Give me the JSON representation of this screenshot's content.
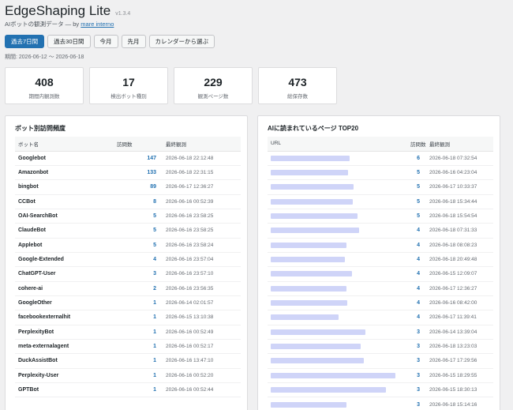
{
  "app": {
    "title": "EdgeShaping Lite",
    "version": "v1.3.4",
    "subtitle_prefix": "AIボットの観測データ — by",
    "author_link": "mare interno"
  },
  "filters": [
    {
      "label": "過去7日間",
      "active": true
    },
    {
      "label": "過去30日間",
      "active": false
    },
    {
      "label": "今月",
      "active": false
    },
    {
      "label": "先月",
      "active": false
    },
    {
      "label": "カレンダーから選ぶ",
      "active": false
    }
  ],
  "period": "期間: 2026-06-12 ～ 2026-06-18",
  "stats": [
    {
      "value": "408",
      "label": "期間内観測数"
    },
    {
      "value": "17",
      "label": "検出ボット種別"
    },
    {
      "value": "229",
      "label": "観測ページ数"
    },
    {
      "value": "473",
      "label": "総保存数"
    }
  ],
  "bot_panel": {
    "title": "ボット別訪問頻度",
    "headers": [
      "ボット名",
      "訪問数",
      "最終観測"
    ],
    "rows": [
      {
        "name": "Googlebot",
        "count": "147",
        "last": "2026-06-18 22:12:48"
      },
      {
        "name": "Amazonbot",
        "count": "133",
        "last": "2026-06-18 22:31:15"
      },
      {
        "name": "bingbot",
        "count": "89",
        "last": "2026-06-17 12:36:27"
      },
      {
        "name": "CCBot",
        "count": "8",
        "last": "2026-06-16 00:52:39"
      },
      {
        "name": "OAI-SearchBot",
        "count": "5",
        "last": "2026-06-16 23:58:25"
      },
      {
        "name": "ClaudeBot",
        "count": "5",
        "last": "2026-06-16 23:58:25"
      },
      {
        "name": "Applebot",
        "count": "5",
        "last": "2026-06-16 23:58:24"
      },
      {
        "name": "Google-Extended",
        "count": "4",
        "last": "2026-06-16 23:57:04"
      },
      {
        "name": "ChatGPT-User",
        "count": "3",
        "last": "2026-06-16 23:57:10"
      },
      {
        "name": "cohere-ai",
        "count": "2",
        "last": "2026-06-16 23:56:35"
      },
      {
        "name": "GoogleOther",
        "count": "1",
        "last": "2026-06-14 02:01:57"
      },
      {
        "name": "facebookexternalhit",
        "count": "1",
        "last": "2026-06-15 13:10:38"
      },
      {
        "name": "PerplexityBot",
        "count": "1",
        "last": "2026-06-16 00:52:49"
      },
      {
        "name": "meta-externalagent",
        "count": "1",
        "last": "2026-06-16 00:52:17"
      },
      {
        "name": "DuckAssistBot",
        "count": "1",
        "last": "2026-06-16 13:47:10"
      },
      {
        "name": "Perplexity-User",
        "count": "1",
        "last": "2026-06-16 00:52:20"
      },
      {
        "name": "GPTBot",
        "count": "1",
        "last": "2026-06-16 00:52:44"
      }
    ]
  },
  "page_panel": {
    "title": "AIに読まれているページ TOP20",
    "headers": [
      "URL",
      "訪問数",
      "最終観測"
    ],
    "rows": [
      {
        "count": "6",
        "last": "2026-06-18 07:32:54"
      },
      {
        "count": "5",
        "last": "2026-06-16 04:23:04"
      },
      {
        "count": "5",
        "last": "2026-06-17 10:33:37"
      },
      {
        "count": "5",
        "last": "2026-06-18 15:34:44"
      },
      {
        "count": "5",
        "last": "2026-06-18 15:54:54"
      },
      {
        "count": "4",
        "last": "2026-06-18 07:31:33"
      },
      {
        "count": "4",
        "last": "2026-06-18 08:08:23"
      },
      {
        "count": "4",
        "last": "2026-06-18 20:49:48"
      },
      {
        "count": "4",
        "last": "2026-06-15 12:09:07"
      },
      {
        "count": "4",
        "last": "2026-06-17 12:36:27"
      },
      {
        "count": "4",
        "last": "2026-06-16 08:42:00"
      },
      {
        "count": "4",
        "last": "2026-06-17 11:39:41"
      },
      {
        "count": "3",
        "last": "2026-06-14 13:39:04"
      },
      {
        "count": "3",
        "last": "2026-06-18 13:23:03"
      },
      {
        "count": "3",
        "last": "2026-06-17 17:29:56"
      },
      {
        "count": "3",
        "last": "2026-06-15 18:29:55"
      },
      {
        "count": "3",
        "last": "2026-06-15 18:30:13"
      },
      {
        "count": "3",
        "last": "2026-06-18 15:14:16"
      }
    ]
  }
}
